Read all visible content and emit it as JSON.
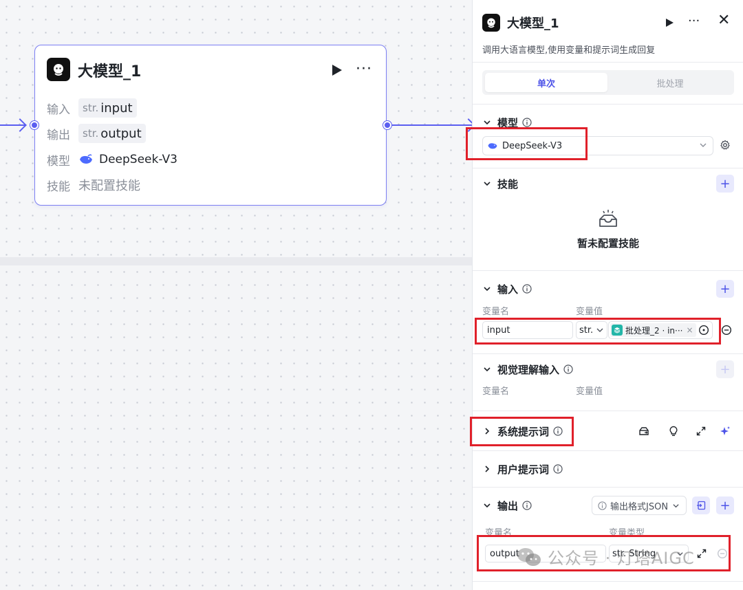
{
  "node": {
    "title": "大模型_1",
    "more": "···",
    "input_label": "输入",
    "input_type": "str.",
    "input_name": "input",
    "output_label": "输出",
    "output_type": "str.",
    "output_name": "output",
    "model_label": "模型",
    "model_name": "DeepSeek-V3",
    "skill_label": "技能",
    "skill_value": "未配置技能"
  },
  "panel": {
    "title": "大模型_1",
    "more": "···",
    "close": "✕",
    "description": "调用大语言模型,使用变量和提示词生成回复",
    "tabs": [
      "单次",
      "批处理"
    ],
    "model_section": {
      "title": "模型",
      "selected": "DeepSeek-V3"
    },
    "skill_section": {
      "title": "技能",
      "empty_text": "暂未配置技能"
    },
    "input_section": {
      "title": "输入",
      "col_name": "变量名",
      "col_value": "变量值",
      "row": {
        "name": "input",
        "type": "str.",
        "ref": "批处理_2 · in···",
        "ref_close": "×"
      }
    },
    "vision_section": {
      "title": "视觉理解输入",
      "col_name": "变量名",
      "col_value": "变量值"
    },
    "system_prompt": {
      "title": "系统提示词"
    },
    "user_prompt": {
      "title": "用户提示词"
    },
    "output_section": {
      "title": "输出",
      "format_label": "输出格式JSON",
      "col_name": "变量名",
      "col_type": "变量类型",
      "row": {
        "name": "output",
        "type": "str. String"
      }
    }
  },
  "watermark": {
    "text": "公众号 · 灯塔AIGC"
  },
  "colors": {
    "accent": "#4d53e8",
    "edge": "#5b5ef0",
    "highlight": "#e0202a",
    "ref_icon": "#23b6a8"
  },
  "icons": [
    "play-icon",
    "more-icon",
    "close-icon",
    "info-icon",
    "chevron-down-icon",
    "chevron-right-icon",
    "gear-icon",
    "plus-icon",
    "empty-box-icon",
    "variable-ref-icon",
    "target-icon",
    "minus-circle-icon",
    "prompt-library-icon",
    "bulb-icon",
    "expand-icon",
    "sparkle-icon",
    "import-icon",
    "wechat-icon",
    "deepseek-whale-icon"
  ]
}
